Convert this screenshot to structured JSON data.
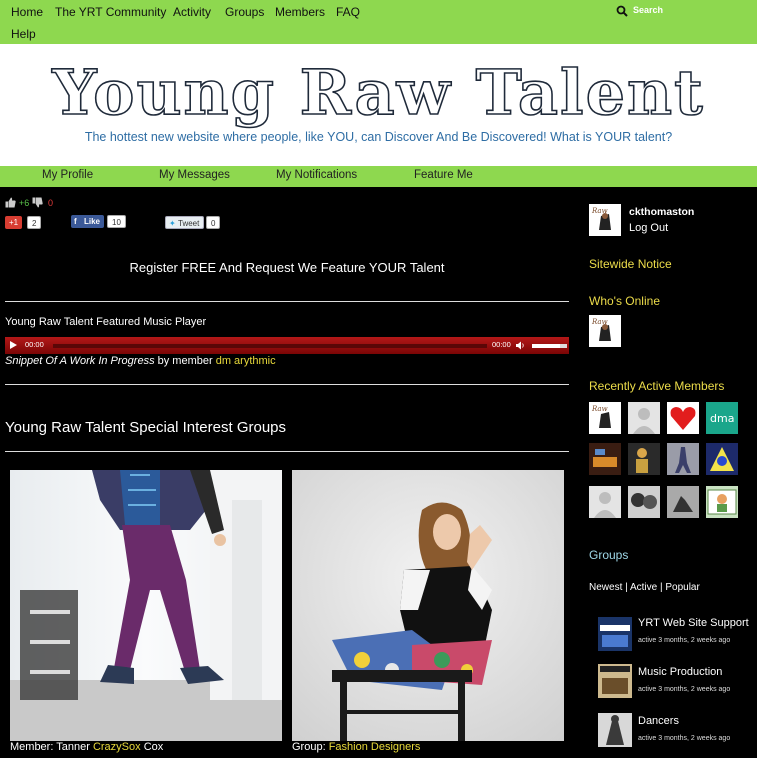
{
  "topnav": {
    "items": [
      "Home",
      "The YRT Community",
      "Activity",
      "Groups",
      "Members",
      "FAQ",
      "Help"
    ],
    "search_label": "Search"
  },
  "header": {
    "logo_text": "Young Raw Talent",
    "tagline": "The hottest new website where people, like YOU, can Discover And Be Discovered! What is YOUR talent?"
  },
  "subnav": {
    "items": [
      "My Profile",
      "My Messages",
      "My Notifications",
      "Feature Me"
    ]
  },
  "social": {
    "likes": "+6",
    "dislikes": "0",
    "gplus_label": "+1",
    "gplus_count": "2",
    "fb_label": "Like",
    "fb_count": "10",
    "tweet_label": "Tweet",
    "tweet_count": "0"
  },
  "main": {
    "register_text": "Register FREE And Request We Feature YOUR Talent",
    "player_label": "Young Raw Talent Featured Music Player",
    "player_time_current": "00:00",
    "player_time_total": "00:00",
    "player_volume": 0.8,
    "snippet_title": "Snippet Of A Work In Progress",
    "snippet_by": " by member ",
    "snippet_member": "dm arythmic",
    "groups_title": "Young Raw Talent Special Interest Groups",
    "card1_prefix": "Member: Tanner ",
    "card1_link": "CrazySox",
    "card1_suffix": " Cox",
    "card2_prefix": "Group: ",
    "card2_link": "Fashion Designers"
  },
  "sidebar": {
    "username": "ckthomaston",
    "logout": "Log Out",
    "sitewide_notice": "Sitewide Notice",
    "whos_online": "Who's Online",
    "recently_active": "Recently Active Members",
    "dma_label": "dma",
    "groups_heading": "Groups",
    "filter_newest": "Newest",
    "filter_active": "Active",
    "filter_popular": "Popular",
    "filter_sep": " | ",
    "groups": [
      {
        "name": "YRT Web Site Support",
        "time": "active 3 months, 2 weeks ago"
      },
      {
        "name": "Music Production",
        "time": "active 3 months, 2 weeks ago"
      },
      {
        "name": "Dancers",
        "time": "active 3 months, 2 weeks ago"
      }
    ]
  },
  "colors": {
    "nav_green": "#8ed84f",
    "link_yellow": "#e8d93a",
    "tagline_blue": "#2e6da4",
    "player_red": "#b41818"
  }
}
